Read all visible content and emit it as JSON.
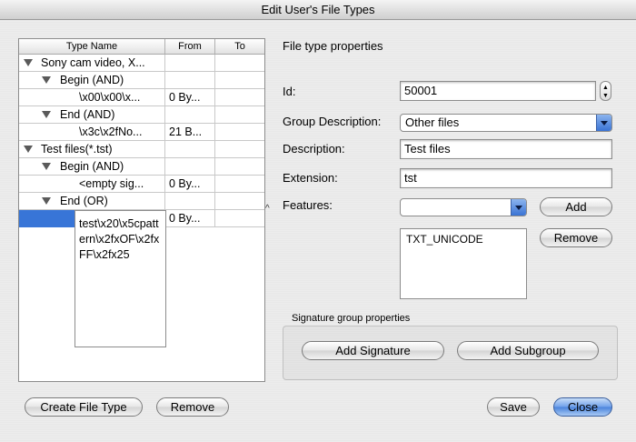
{
  "window": {
    "title": "Edit User's File Types"
  },
  "table": {
    "columns": [
      "Type Name",
      "From",
      "To"
    ],
    "rows": [
      {
        "name": "Sony cam video, X...",
        "from": "",
        "to": "",
        "level": 0,
        "expanded": true
      },
      {
        "name": "Begin (AND)",
        "from": "",
        "to": "",
        "level": 1,
        "expanded": true
      },
      {
        "name": "\\x00\\x00\\x...",
        "from": "0 By...",
        "to": "",
        "level": 2
      },
      {
        "name": "End (AND)",
        "from": "",
        "to": "",
        "level": 1,
        "expanded": true
      },
      {
        "name": "\\x3c\\x2fNo...",
        "from": "21 B...",
        "to": "",
        "level": 2
      },
      {
        "name": "Test files(*.tst)",
        "from": "",
        "to": "",
        "level": 0,
        "expanded": true
      },
      {
        "name": "Begin (AND)",
        "from": "",
        "to": "",
        "level": 1,
        "expanded": true
      },
      {
        "name": "<empty sig...",
        "from": "0 By...",
        "to": "",
        "level": 2
      },
      {
        "name": "End (OR)",
        "from": "",
        "to": "",
        "level": 1,
        "expanded": true
      },
      {
        "name": "",
        "from": "0 By...",
        "to": "",
        "level": 2,
        "selected": true
      }
    ],
    "editor_value": "test\\x20\\x5cpattern\\x2fxOF\\x2fxFF\\x2fx25"
  },
  "properties": {
    "heading": "File type properties",
    "id_label": "Id:",
    "id_value": "50001",
    "group_label": "Group Description:",
    "group_value": "Other files",
    "description_label": "Description:",
    "description_value": "Test files",
    "extension_label": "Extension:",
    "extension_value": "tst",
    "features_label": "Features:",
    "features_value": "",
    "features_add": "Add",
    "features_remove": "Remove",
    "features_list": [
      "TXT_UNICODE"
    ]
  },
  "signature_group": {
    "title": "Signature group properties",
    "add_signature": "Add Signature",
    "add_subgroup": "Add Subgroup"
  },
  "footer": {
    "create": "Create File Type",
    "remove": "Remove",
    "save": "Save",
    "close": "Close"
  },
  "colors": {
    "selection": "#3875d7",
    "accent": "#4a83dc"
  }
}
